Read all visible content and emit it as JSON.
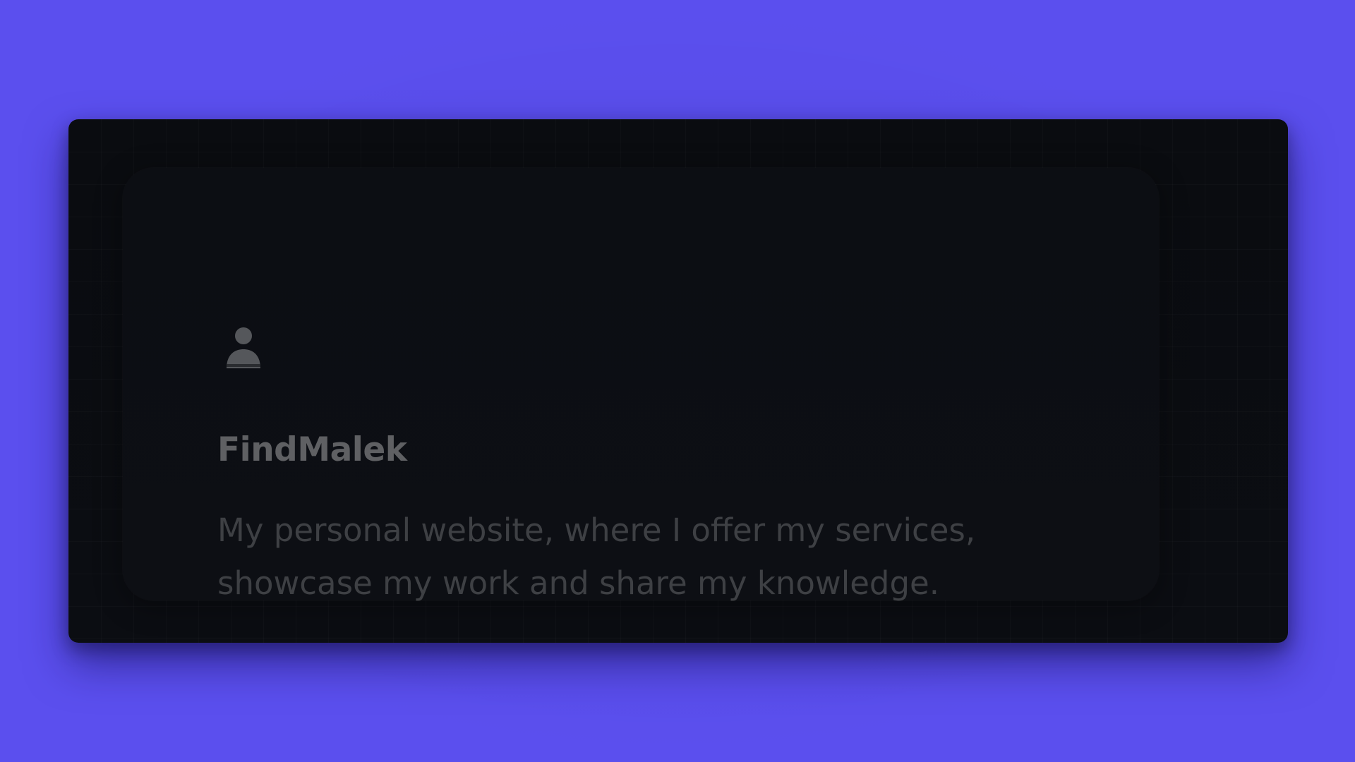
{
  "card": {
    "icon": "user-icon",
    "title": "FindMalek",
    "description": "My personal website, where I offer my services, showcase my work and share my knowledge."
  },
  "colors": {
    "background": "#5b4fee",
    "frame": "#0a0c10",
    "card": "#0d0f14",
    "title_text": "#5f6063",
    "description_text": "#3e4044",
    "icon": "#55575b"
  }
}
